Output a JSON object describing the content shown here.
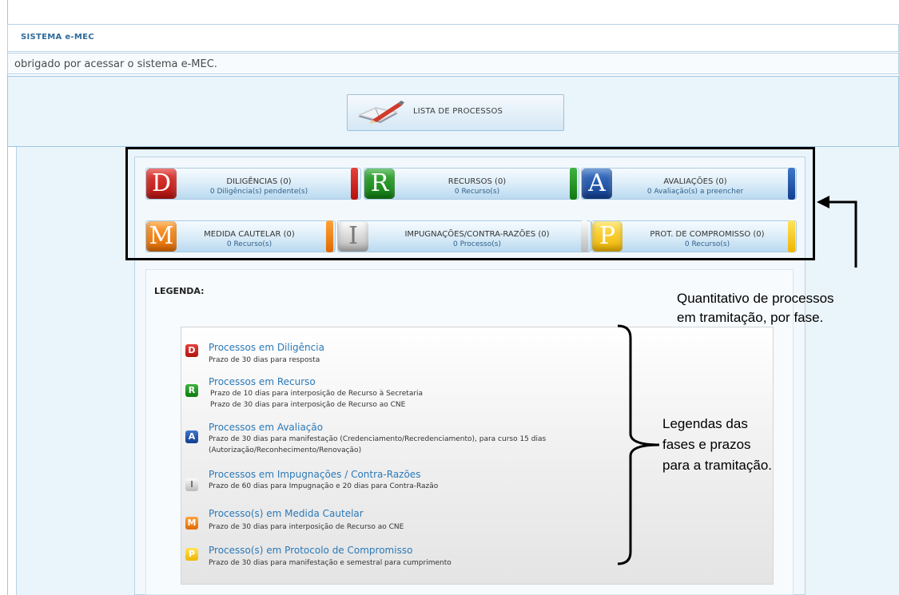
{
  "header": {
    "system_title": "SISTEMA e-MEC",
    "notice": "obrigado por acessar o sistema e-MEC."
  },
  "lista_button": {
    "label": "LISTA DE PROCESSOS",
    "icon": "book-pen-icon"
  },
  "phases": [
    {
      "letter": "D",
      "name": "DILIGÊNCIAS (0)",
      "subtitle": "0 Diligência(s) pendente(s)",
      "color": "#c8201c"
    },
    {
      "letter": "R",
      "name": "RECURSOS (0)",
      "subtitle": "0 Recurso(s)",
      "color": "#1f9a1f"
    },
    {
      "letter": "A",
      "name": "AVALIAÇÕES (0)",
      "subtitle": "0 Avaliação(s) a preencher",
      "color": "#1e56b0"
    },
    {
      "letter": "M",
      "name": "MEDIDA CAUTELAR (0)",
      "subtitle": "0 Recurso(s)",
      "color": "#f28a1a"
    },
    {
      "letter": "I",
      "name": "IMPUGNAÇÕES/CONTRA-RAZÕES (0)",
      "subtitle": "0 Processo(s)",
      "color": "#a0a0a0"
    },
    {
      "letter": "P",
      "name": "PROT. DE COMPROMISSO (0)",
      "subtitle": "0 Recurso(s)",
      "color": "#f7c600"
    }
  ],
  "legend": {
    "title": "LEGENDA:",
    "items": [
      {
        "letter": "D",
        "title": "Processos em Diligência",
        "lines": [
          "Prazo de 30 dias para resposta"
        ]
      },
      {
        "letter": "R",
        "title": "Processos em Recurso",
        "lines": [
          "Prazo de 10 dias para interposição de Recurso à Secretaria",
          "Prazo de 30 dias para interposição de Recurso ao CNE"
        ]
      },
      {
        "letter": "A",
        "title": "Processos em Avaliação",
        "lines": [
          "Prazo de 30 dias para manifestação (Credenciamento/Recredenciamento), para curso 15 dias",
          "(Autorização/Reconhecimento/Renovação)"
        ]
      },
      {
        "letter": "I",
        "title": "Processos em Impugnações / Contra-Razões",
        "lines": [
          "Prazo de 60 dias para Impugnação e 20 dias para Contra-Razão"
        ]
      },
      {
        "letter": "M",
        "title": "Processo(s) em Medida Cautelar",
        "lines": [
          "Prazo de 30 dias para interposição de Recurso ao CNE"
        ]
      },
      {
        "letter": "P",
        "title": "Processo(s) em Protocolo de Compromisso",
        "lines": [
          "Prazo de 30 dias para manifestação e semestral para cumprimento"
        ]
      }
    ]
  },
  "annotations": {
    "quantitativo_line1": "Quantitativo de processos",
    "quantitativo_line2": "em tramitação, por fase.",
    "legendas_line1": "Legendas das",
    "legendas_line2": "fases e prazos",
    "legendas_line3": "para a tramitação."
  }
}
